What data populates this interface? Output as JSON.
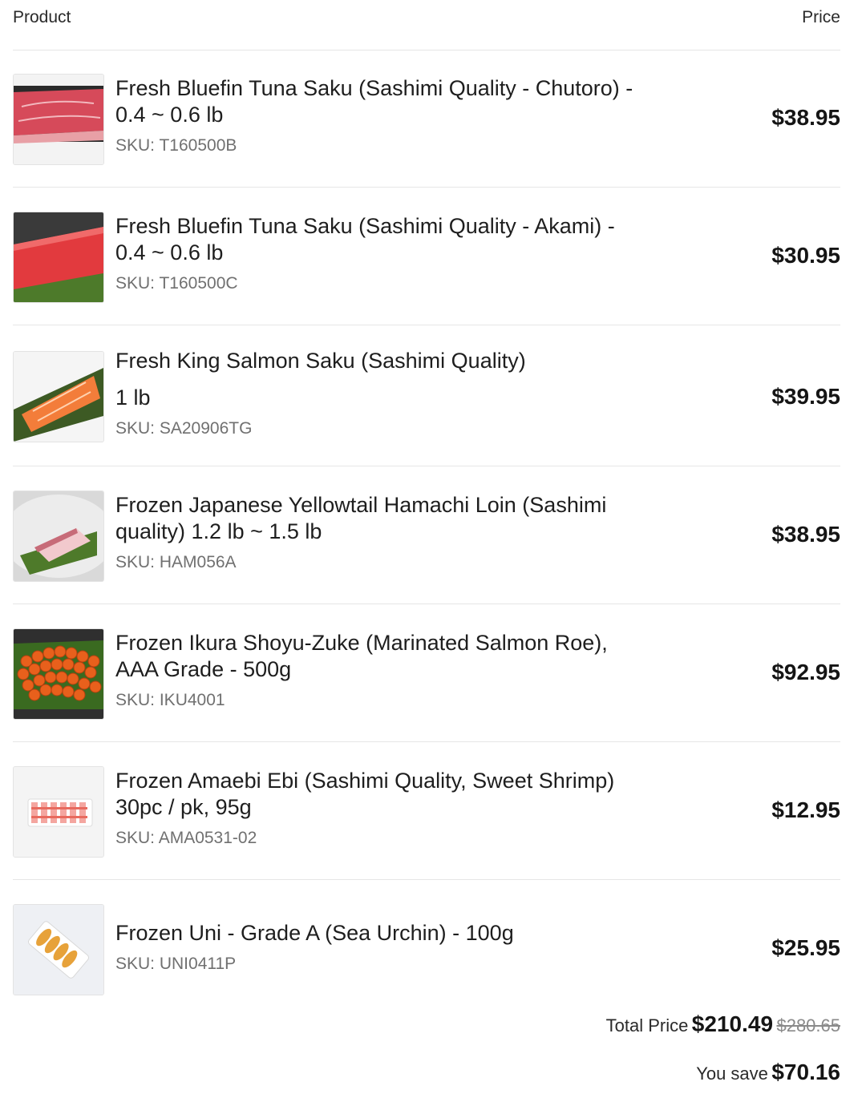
{
  "header": {
    "product_label": "Product",
    "price_label": "Price"
  },
  "items": [
    {
      "title": "Fresh Bluefin Tuna Saku (Sashimi Quality - Chutoro) -",
      "title2": "0.4 ~ 0.6 lb",
      "sku": "SKU: T160500B",
      "price": "$38.95",
      "image": "tuna-chutoro"
    },
    {
      "title": "Fresh Bluefin Tuna Saku (Sashimi Quality - Akami) -",
      "title2": "0.4 ~ 0.6 lb",
      "sku": "SKU: T160500C",
      "price": "$30.95",
      "image": "tuna-akami"
    },
    {
      "title": "Fresh King Salmon Saku (Sashimi Quality)",
      "title2": "1 lb",
      "sku": "SKU: SA20906TG",
      "price": "$39.95",
      "image": "salmon"
    },
    {
      "title": "Frozen Japanese Yellowtail Hamachi Loin (Sashimi",
      "title2": "quality) 1.2 lb ~ 1.5 lb",
      "sku": "SKU: HAM056A",
      "price": "$38.95",
      "image": "hamachi"
    },
    {
      "title": "Frozen Ikura Shoyu-Zuke (Marinated Salmon Roe),",
      "title2": "AAA Grade - 500g",
      "sku": "SKU: IKU4001",
      "price": "$92.95",
      "image": "ikura"
    },
    {
      "title": "Frozen Amaebi Ebi (Sashimi Quality, Sweet Shrimp)",
      "title2": "30pc / pk, 95g",
      "sku": "SKU: AMA0531-02",
      "price": "$12.95",
      "image": "amaebi"
    },
    {
      "title": "Frozen Uni - Grade A (Sea Urchin) - 100g",
      "title2": "",
      "sku": "SKU: UNI0411P",
      "price": "$25.95",
      "image": "uni"
    }
  ],
  "summary": {
    "total_label": "Total Price",
    "total": "$210.49",
    "original_total": "$280.65",
    "save_label": "You save",
    "save_amount": "$70.16"
  }
}
